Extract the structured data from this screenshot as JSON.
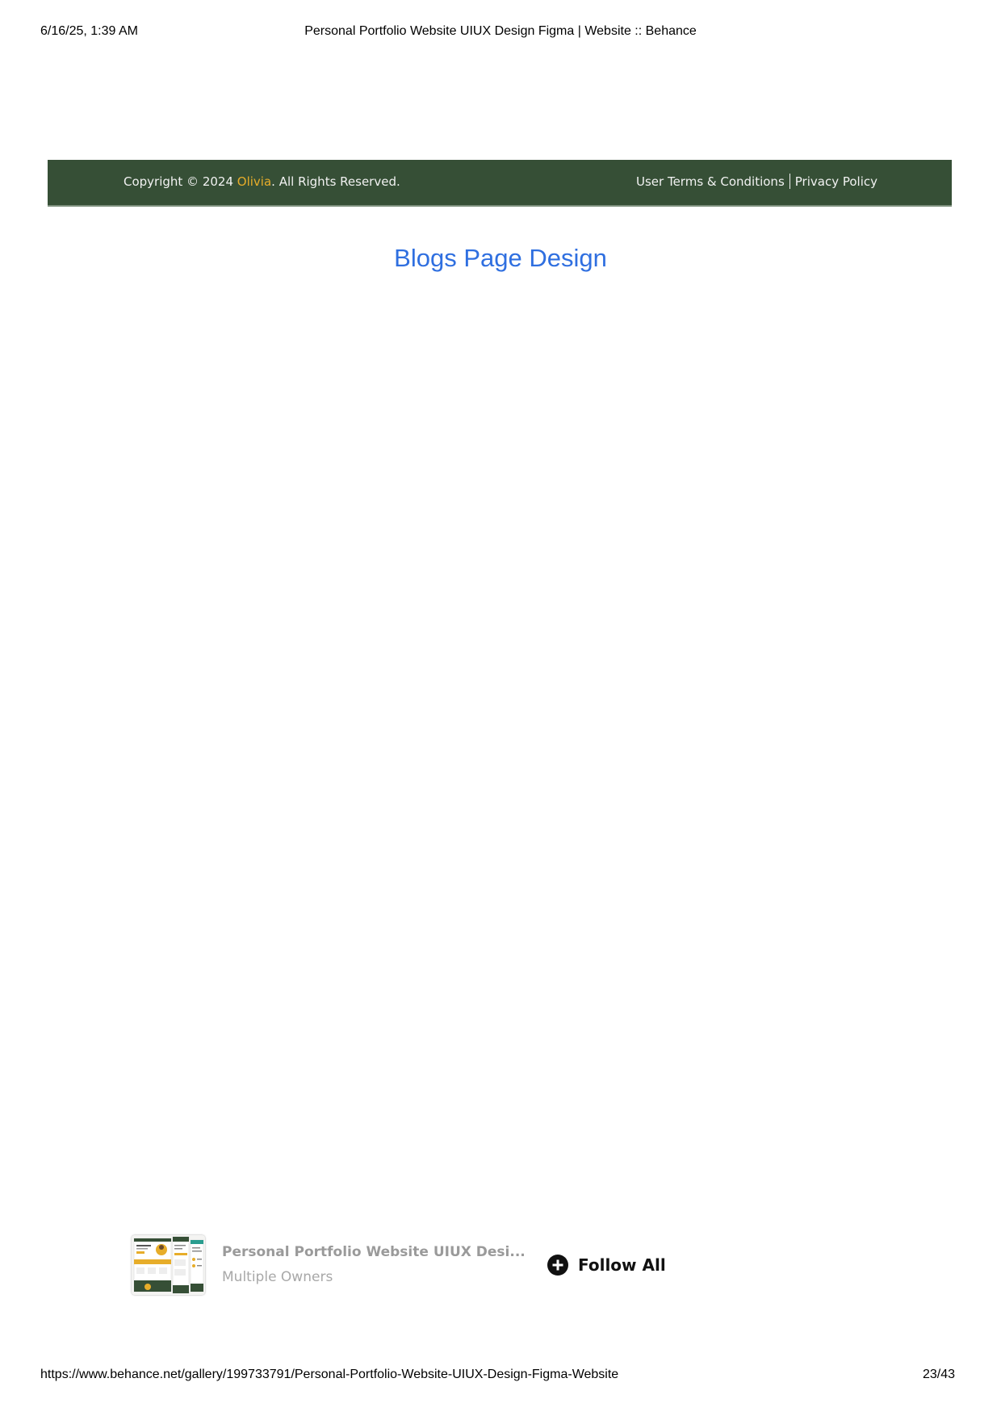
{
  "print_header": {
    "datetime": "6/16/25, 1:39 AM",
    "document_title": "Personal Portfolio Website UIUX Design Figma | Website :: Behance"
  },
  "site_footer": {
    "copyright_prefix": "Copyright © 2024 ",
    "owner_name": "Olivia",
    "copyright_suffix": ". All Rights Reserved.",
    "terms_link": "User Terms & Conditions",
    "privacy_link": "Privacy Policy",
    "background_color": "#364f36",
    "accent_color": "#e7ad2a"
  },
  "section": {
    "heading": "Blogs Page Design",
    "heading_color": "#2f6fe0"
  },
  "project_bar": {
    "title": "Personal Portfolio Website UIUX Desi...",
    "owners": "Multiple Owners",
    "follow_label": "Follow All",
    "follow_icon": "plus-circle-icon"
  },
  "print_footer": {
    "url": "https://www.behance.net/gallery/199733791/Personal-Portfolio-Website-UIUX-Design-Figma-Website",
    "page_indicator": "23/43"
  }
}
